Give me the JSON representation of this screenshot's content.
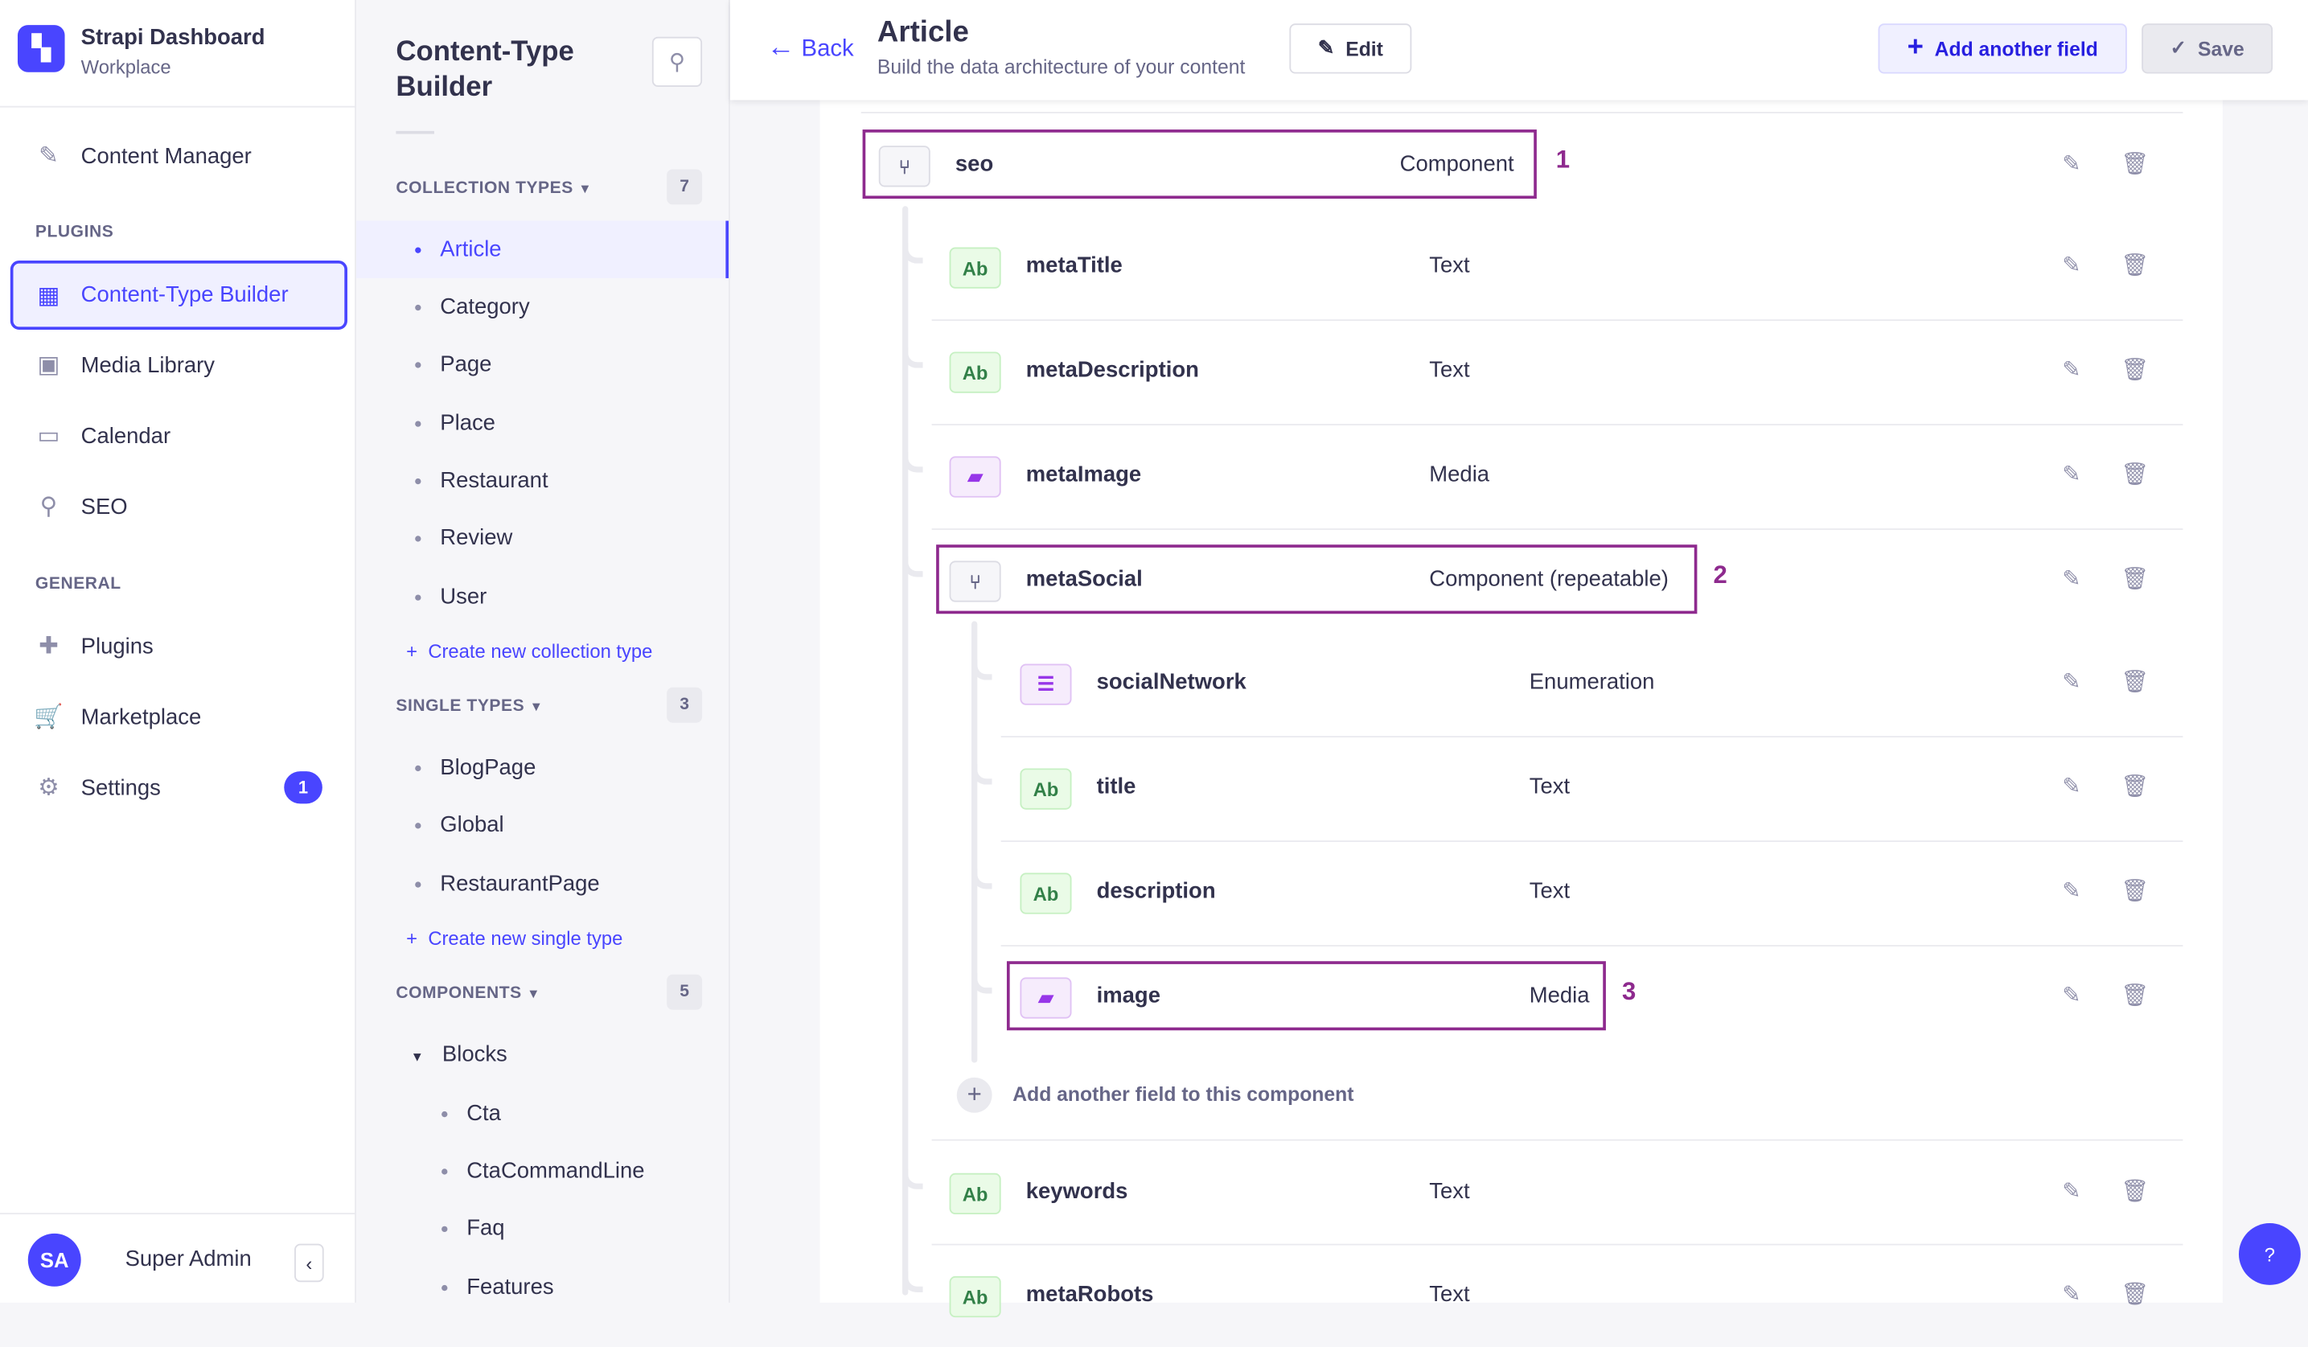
{
  "nav": {
    "app_title": "Strapi Dashboard",
    "workspace": "Workplace",
    "logo_letter": "S",
    "content_manager": "Content Manager",
    "plugins_label": "PLUGINS",
    "general_label": "GENERAL",
    "items": [
      {
        "label": "Content-Type Builder",
        "icon": "layout-icon"
      },
      {
        "label": "Media Library",
        "icon": "image-icon"
      },
      {
        "label": "Calendar",
        "icon": "calendar-icon"
      },
      {
        "label": "SEO",
        "icon": "search-icon"
      }
    ],
    "general": [
      {
        "label": "Plugins",
        "icon": "puzzle-icon"
      },
      {
        "label": "Marketplace",
        "icon": "cart-icon"
      },
      {
        "label": "Settings",
        "icon": "gear-icon",
        "badge": "1"
      }
    ],
    "user_initials": "SA",
    "user_name": "Super Admin",
    "accent": "#4945ff"
  },
  "panel": {
    "title": "Content-Type Builder",
    "collection": {
      "label": "COLLECTION TYPES",
      "count": "7",
      "items": [
        "Article",
        "Category",
        "Page",
        "Place",
        "Restaurant",
        "Review",
        "User"
      ],
      "create": "Create new collection type"
    },
    "single": {
      "label": "SINGLE TYPES",
      "count": "3",
      "items": [
        "BlogPage",
        "Global",
        "RestaurantPage"
      ],
      "create": "Create new single type"
    },
    "components": {
      "label": "COMPONENTS",
      "count": "5",
      "group": "Blocks",
      "items": [
        "Cta",
        "CtaCommandLine",
        "Faq",
        "Features"
      ]
    }
  },
  "header": {
    "back": "Back",
    "title": "Article",
    "subtitle": "Build the data architecture of your content",
    "edit": "Edit",
    "add_field": "Add another field",
    "save": "Save"
  },
  "fields": [
    {
      "name": "seo",
      "type": "Component",
      "icon": "component-icon",
      "badge": "",
      "highlight": "1"
    },
    {
      "name": "metaTitle",
      "type": "Text",
      "icon": "text-icon",
      "badge": "Ab"
    },
    {
      "name": "metaDescription",
      "type": "Text",
      "icon": "text-icon",
      "badge": "Ab"
    },
    {
      "name": "metaImage",
      "type": "Media",
      "icon": "media-icon",
      "badge": ""
    },
    {
      "name": "metaSocial",
      "type": "Component (repeatable)",
      "icon": "component-icon",
      "badge": "",
      "highlight": "2"
    },
    {
      "name": "socialNetwork",
      "type": "Enumeration",
      "icon": "list-icon",
      "badge": ""
    },
    {
      "name": "title",
      "type": "Text",
      "icon": "text-icon",
      "badge": "Ab"
    },
    {
      "name": "description",
      "type": "Text",
      "icon": "text-icon",
      "badge": "Ab"
    },
    {
      "name": "image",
      "type": "Media",
      "icon": "media-icon",
      "badge": "",
      "highlight": "3"
    },
    {
      "name": "keywords",
      "type": "Text",
      "icon": "text-icon",
      "badge": "Ab"
    },
    {
      "name": "metaRobots",
      "type": "Text",
      "icon": "text-icon",
      "badge": "Ab"
    }
  ],
  "add_component_field": "Add another field to this component",
  "help": "?"
}
